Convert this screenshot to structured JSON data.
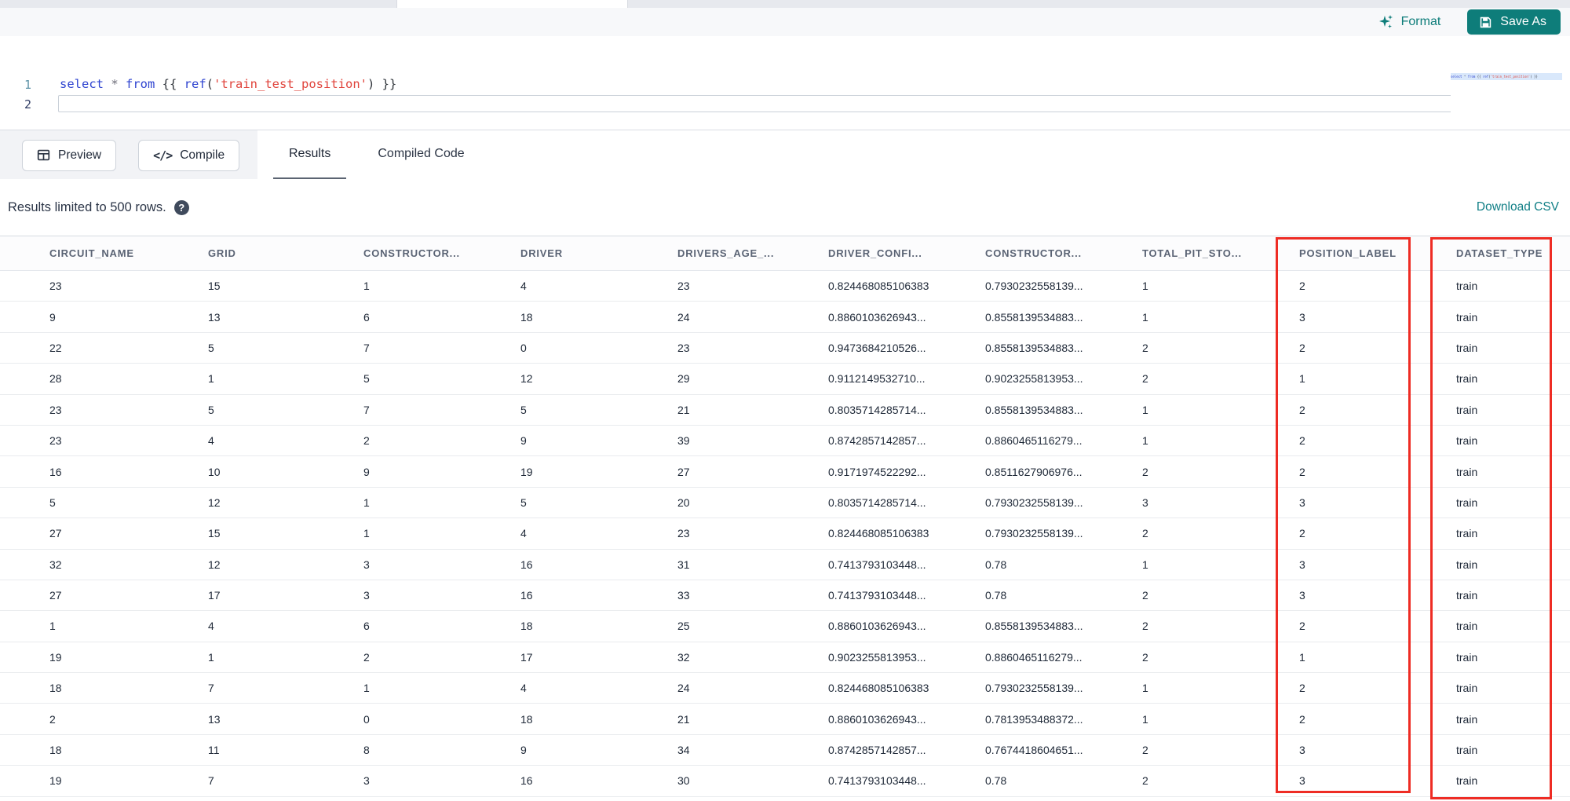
{
  "toolbar": {
    "format_label": "Format",
    "save_as_label": "Save As"
  },
  "editor": {
    "line_numbers": {
      "line1": "1",
      "line2": "2"
    },
    "tokens": [
      {
        "t": "select ",
        "c": "kw"
      },
      {
        "t": "* ",
        "c": "op"
      },
      {
        "t": "from ",
        "c": "kw"
      },
      {
        "t": "{{ ",
        "c": "punct"
      },
      {
        "t": "ref",
        "c": "fn"
      },
      {
        "t": "(",
        "c": "punct"
      },
      {
        "t": "'train_test_position'",
        "c": "str"
      },
      {
        "t": ") }}",
        "c": "punct"
      }
    ]
  },
  "actions": {
    "preview_label": "Preview",
    "compile_label": "Compile",
    "compile_glyph": "</>",
    "tabs": [
      {
        "label": "Results",
        "active": true
      },
      {
        "label": "Compiled Code",
        "active": false
      }
    ]
  },
  "results": {
    "limit_notice": "Results limited to 500 rows.",
    "help_glyph": "?",
    "download_csv_label": "Download CSV"
  },
  "table": {
    "columns": [
      "CIRCUIT_NAME",
      "GRID",
      "CONSTRUCTOR...",
      "DRIVER",
      "DRIVERS_AGE_...",
      "DRIVER_CONFI...",
      "CONSTRUCTOR...",
      "TOTAL_PIT_STO...",
      "POSITION_LABEL",
      "DATASET_TYPE"
    ],
    "rows": [
      [
        "23",
        "15",
        "1",
        "4",
        "23",
        "0.824468085106383",
        "0.7930232558139...",
        "1",
        "2",
        "train"
      ],
      [
        "9",
        "13",
        "6",
        "18",
        "24",
        "0.8860103626943...",
        "0.8558139534883...",
        "1",
        "3",
        "train"
      ],
      [
        "22",
        "5",
        "7",
        "0",
        "23",
        "0.9473684210526...",
        "0.8558139534883...",
        "2",
        "2",
        "train"
      ],
      [
        "28",
        "1",
        "5",
        "12",
        "29",
        "0.9112149532710...",
        "0.9023255813953...",
        "2",
        "1",
        "train"
      ],
      [
        "23",
        "5",
        "7",
        "5",
        "21",
        "0.8035714285714...",
        "0.8558139534883...",
        "1",
        "2",
        "train"
      ],
      [
        "23",
        "4",
        "2",
        "9",
        "39",
        "0.8742857142857...",
        "0.8860465116279...",
        "1",
        "2",
        "train"
      ],
      [
        "16",
        "10",
        "9",
        "19",
        "27",
        "0.9171974522292...",
        "0.8511627906976...",
        "2",
        "2",
        "train"
      ],
      [
        "5",
        "12",
        "1",
        "5",
        "20",
        "0.8035714285714...",
        "0.7930232558139...",
        "3",
        "3",
        "train"
      ],
      [
        "27",
        "15",
        "1",
        "4",
        "23",
        "0.824468085106383",
        "0.7930232558139...",
        "2",
        "2",
        "train"
      ],
      [
        "32",
        "12",
        "3",
        "16",
        "31",
        "0.7413793103448...",
        "0.78",
        "1",
        "3",
        "train"
      ],
      [
        "27",
        "17",
        "3",
        "16",
        "33",
        "0.7413793103448...",
        "0.78",
        "2",
        "3",
        "train"
      ],
      [
        "1",
        "4",
        "6",
        "18",
        "25",
        "0.8860103626943...",
        "0.8558139534883...",
        "2",
        "2",
        "train"
      ],
      [
        "19",
        "1",
        "2",
        "17",
        "32",
        "0.9023255813953...",
        "0.8860465116279...",
        "2",
        "1",
        "train"
      ],
      [
        "18",
        "7",
        "1",
        "4",
        "24",
        "0.824468085106383",
        "0.7930232558139...",
        "1",
        "2",
        "train"
      ],
      [
        "2",
        "13",
        "0",
        "18",
        "21",
        "0.8860103626943...",
        "0.7813953488372...",
        "1",
        "2",
        "train"
      ],
      [
        "18",
        "11",
        "8",
        "9",
        "34",
        "0.8742857142857...",
        "0.7674418604651...",
        "2",
        "3",
        "train"
      ],
      [
        "19",
        "7",
        "3",
        "16",
        "30",
        "0.7413793103448...",
        "0.78",
        "2",
        "3",
        "train"
      ]
    ]
  },
  "annotations": {
    "highlight_color": "#ee2c24",
    "highlighted_columns": [
      "POSITION_LABEL",
      "DATASET_TYPE"
    ]
  },
  "icons": {
    "format": "sparkles-icon",
    "save_as": "floppy-disk-icon",
    "preview": "table-grid-icon",
    "compile": "code-icon",
    "help": "question-mark-icon"
  },
  "colors": {
    "accent_teal": "#0e7d7a",
    "link_teal": "#0f7e85",
    "annotation_red": "#ee2c24"
  }
}
